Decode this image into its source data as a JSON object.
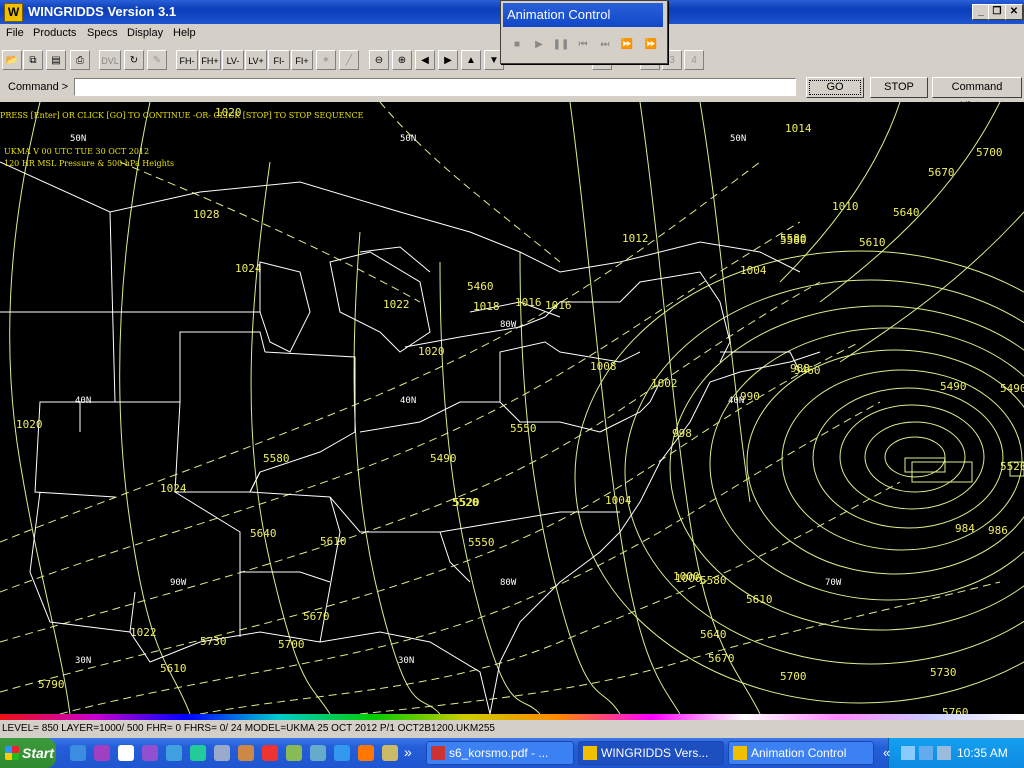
{
  "window": {
    "title": "WINGRIDDS Version 3.1",
    "icon_letter": "W",
    "min": "_",
    "max": "❐",
    "close": "✕"
  },
  "menu": [
    "File",
    "Products",
    "Specs",
    "Display",
    "Help"
  ],
  "toolbar": {
    "fh_minus": "FH-",
    "fh_plus": "FH+",
    "lv_minus": "LV-",
    "lv_plus": "LV+",
    "fi_minus": "FI-",
    "fi_plus": "FI+",
    "dvl": "DVL",
    "frame_2": "2",
    "frame_3": "3",
    "frame_4": "4"
  },
  "command": {
    "label": "Command >",
    "value": "",
    "go": "GO",
    "stop": "STOP",
    "history": "Command History"
  },
  "animation_control": {
    "title": "Animation Control"
  },
  "map": {
    "prompt": "PRESS [Enter] OR CLICK [GO] TO CONTINUE -OR- CLICK [STOP] TO STOP SEQUENCE",
    "line1": "UKMA   V 00 UTC TUE 30 OCT 2012",
    "line2": "120 HR MSL Pressure & 500 hPa Heights",
    "labels": {
      "h1": "1020",
      "h2": "1028",
      "h3": "1024",
      "h4": "1020",
      "h5": "1024",
      "h6": "1022",
      "h7": "1022",
      "h8": "1020",
      "h9": "1018",
      "h10": "1016",
      "h11": "1016",
      "h12": "1014",
      "h13": "1012",
      "h14": "1010",
      "h15": "1008",
      "h16": "1004",
      "h17": "1004",
      "h18": "1002",
      "h19": "998",
      "h20": "1000",
      "h21": "1006",
      "h22": "988",
      "h23": "990",
      "h24": "984",
      "h25": "986",
      "g1": "5700",
      "g2": "5670",
      "g3": "5640",
      "g4": "5610",
      "g5": "5580",
      "g6": "5550",
      "g7": "5520",
      "g8": "5490",
      "g9": "5460",
      "g10": "5580",
      "g11": "5610",
      "g12": "5640",
      "g13": "5670",
      "g14": "5700",
      "g15": "5730",
      "g16": "5760",
      "g17": "5790",
      "g18": "5730",
      "g19": "5700",
      "g20": "5670",
      "g21": "5610",
      "g22": "5580",
      "g23": "5550",
      "g24": "5520",
      "g25": "5490",
      "g26": "5460",
      "g27": "5490",
      "g28": "5520",
      "g29": "5580",
      "g30": "5640",
      "g31": "5610",
      "lat50a": "50N",
      "lat50b": "50N",
      "lat50c": "50N",
      "lat40a": "40N",
      "lat40b": "40N",
      "lat40c": "40N",
      "lat30a": "30N",
      "lat30b": "30N",
      "lon90": "90W",
      "lon80": "80W",
      "lon70": "70W",
      "lon80b": "80W"
    }
  },
  "status": "LEVEL= 850 LAYER=1000/ 500 FHR=  0 FHRS=  0/ 24 MODEL=UKMA  25 OCT 2012 P/1 OCT2B1200.UKM255",
  "taskbar": {
    "start": "Start",
    "more": "»",
    "tasks": [
      "s6_korsmo.pdf - ...",
      "WINGRIDDS Vers...",
      "Animation Control"
    ],
    "tray_arrow": "«",
    "clock": "10:35 AM"
  },
  "colors": {
    "contour": "#d8f08a",
    "coast": "#ffffff",
    "label": "#f0f060",
    "overlay": "#e8e000"
  }
}
